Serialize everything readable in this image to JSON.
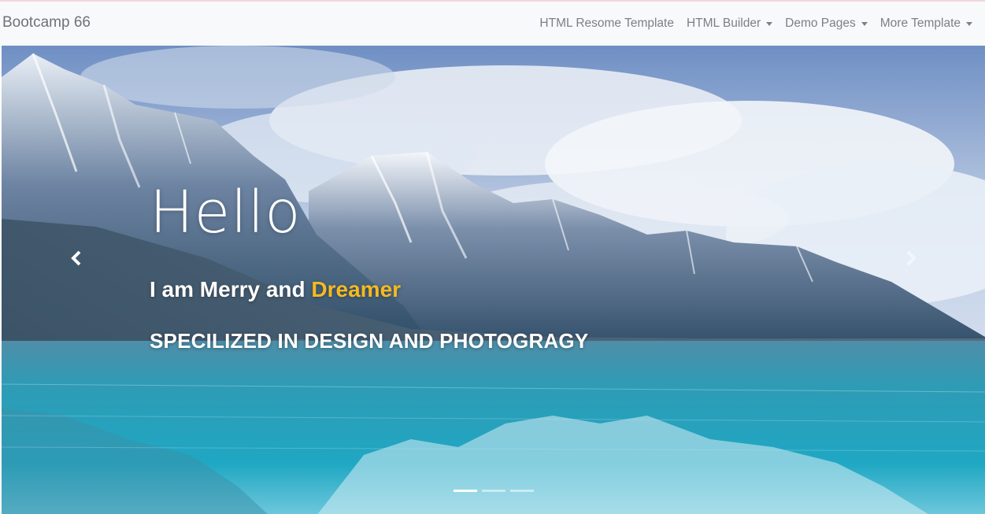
{
  "navbar": {
    "brand": "Bootcamp 66",
    "items": [
      {
        "label": "HTML Resome Template",
        "dropdown": false
      },
      {
        "label": "HTML Builder",
        "dropdown": true
      },
      {
        "label": "Demo Pages",
        "dropdown": true
      },
      {
        "label": "More Template",
        "dropdown": true
      }
    ]
  },
  "hero": {
    "heading": "Hello",
    "tagline_prefix": "I am Merry and ",
    "tagline_accent": "Dreamer",
    "subtitle": "SPECILIZED IN DESIGN AND PHOTOGRAGY",
    "slide_count": 3,
    "active_slide": 1
  },
  "colors": {
    "accent": "#f5b921",
    "navbar_bg": "#f8f9fa",
    "nav_text": "#7a8187"
  },
  "icons": {
    "prev": "chevron-left-icon",
    "next": "chevron-right-icon"
  }
}
